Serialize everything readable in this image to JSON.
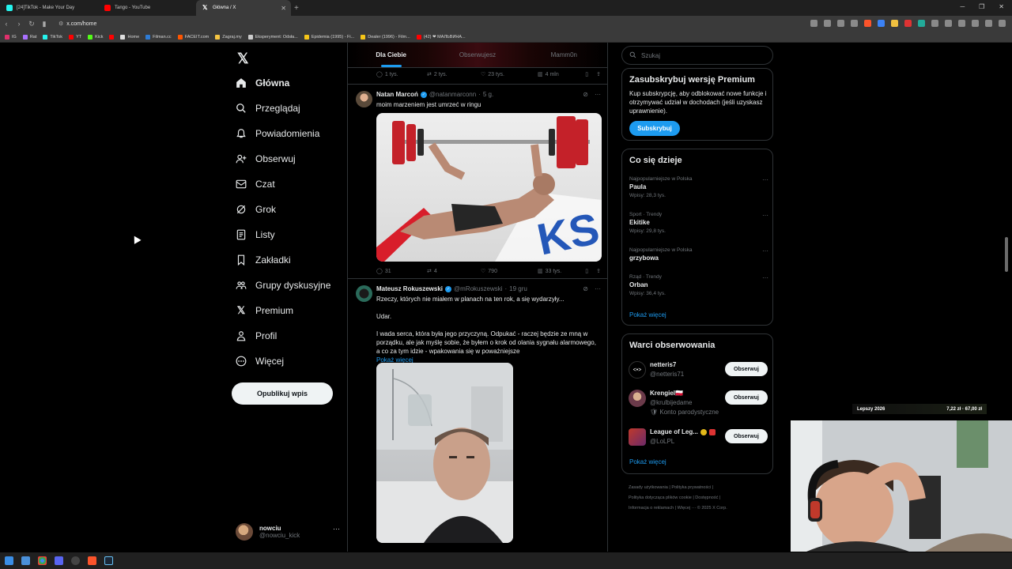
{
  "browser": {
    "tabs": [
      {
        "title": "[24]TikTok - Make Your Day",
        "color": "#25f4ee"
      },
      {
        "title": "Tango - YouTube",
        "color": "#ff0000"
      },
      {
        "title": "Główna / X",
        "color": "#ffffff",
        "active": true
      }
    ],
    "url": "x.com/home",
    "bookmarks": [
      {
        "label": "IG",
        "color": "#e1306c"
      },
      {
        "label": "Rat",
        "color": "#a970ff"
      },
      {
        "label": "TikTok",
        "color": "#25f4ee"
      },
      {
        "label": "YT",
        "color": "#ff0000"
      },
      {
        "label": "Kick",
        "color": "#53fc18"
      },
      {
        "label": "",
        "color": "#ff0000"
      },
      {
        "label": "Home",
        "color": "#ffffff"
      },
      {
        "label": "Filman.cc",
        "color": "#2e7cd6"
      },
      {
        "label": "FACEIT.com",
        "color": "#ff5500"
      },
      {
        "label": "Zagraj.my",
        "color": "#f5c542"
      },
      {
        "label": "Eksperyment: Odsła...",
        "color": "#cccccc"
      },
      {
        "label": "Epidemia (1995) - Fi...",
        "color": "#f5c518"
      },
      {
        "label": "Dealer (1996) - Film...",
        "color": "#f5c518"
      },
      {
        "label": "(42) ❤ МАЛЬВИНА...",
        "color": "#888888"
      }
    ]
  },
  "nav": {
    "items": [
      {
        "label": "Główna",
        "icon": "home-icon"
      },
      {
        "label": "Przeglądaj",
        "icon": "search-icon"
      },
      {
        "label": "Powiadomienia",
        "icon": "bell-icon"
      },
      {
        "label": "Obserwuj",
        "icon": "follow-icon"
      },
      {
        "label": "Czat",
        "icon": "mail-icon"
      },
      {
        "label": "Grok",
        "icon": "grok-icon"
      },
      {
        "label": "Listy",
        "icon": "list-icon"
      },
      {
        "label": "Zakładki",
        "icon": "bookmark-icon"
      },
      {
        "label": "Grupy dyskusyjne",
        "icon": "community-icon"
      },
      {
        "label": "Premium",
        "icon": "x-icon"
      },
      {
        "label": "Profil",
        "icon": "profile-icon"
      },
      {
        "label": "Więcej",
        "icon": "more-icon"
      }
    ],
    "post_button": "Opublikuj wpis",
    "profile": {
      "name": "nowciu",
      "handle": "@nowciu_kick"
    }
  },
  "timeline": {
    "tabs": [
      "Dla Ciebie",
      "Obserwujesz",
      "Mamm0n"
    ],
    "prev_actions": {
      "replies": "1 tys.",
      "reposts": "2 tys.",
      "likes": "23 tys.",
      "views": "4 mln"
    },
    "posts": [
      {
        "name": "Natan Marcoń",
        "handle": "@natanmarconn",
        "time": "5 g.",
        "text": "moim marzeniem jest umrzeć w ringu",
        "actions": {
          "replies": "31",
          "reposts": "4",
          "likes": "790",
          "views": "33 tys."
        }
      },
      {
        "name": "Mateusz Rokuszewski",
        "handle": "@mRokuszewski",
        "time": "19 gru",
        "line1": "Rzeczy, których nie miałem w planach na ten rok, a się wydarzyły...",
        "line2": "Udar.",
        "line3": "I wada serca, która była jego przyczyną. Odpukać - raczej będzie ze mną w porządku, ale jak myślę sobie, że byłem o krok od olania sygnału alarmowego, a co za tym idzie - wpakowania się w poważniejsze",
        "show_more": "Pokaż więcej"
      }
    ]
  },
  "sidebar": {
    "search_placeholder": "Szukaj",
    "premium": {
      "title": "Zasubskrybuj wersję Premium",
      "text": "Kup subskrypcję, aby odblokować nowe funkcje i otrzymywać udział w dochodach (jeśli uzyskasz uprawnienie).",
      "button": "Subskrybuj"
    },
    "trends": {
      "title": "Co się dzieje",
      "items": [
        {
          "meta": "Najpopularniejsze w Polska",
          "name": "Paula",
          "count": "Wpisy: 28,3 tys."
        },
        {
          "meta": "Sport · Trendy",
          "name": "Ekitike",
          "count": "Wpisy: 29,8 tys."
        },
        {
          "meta": "Najpopularniejsze w Polska",
          "name": "grzybowa",
          "count": ""
        },
        {
          "meta": "Rząd · Trendy",
          "name": "Orban",
          "count": "Wpisy: 36,4 tys."
        }
      ],
      "show_more": "Pokaż więcej"
    },
    "who_to_follow": {
      "title": "Warci obserwowania",
      "items": [
        {
          "name": "netteris7",
          "handle": "@netteris71",
          "note": ""
        },
        {
          "name": "Krengiel🇵🇱",
          "handle": "@krulbijedame",
          "note": "🛡 Konto parodystyczne"
        },
        {
          "name": "League of Leg...",
          "handle": "@LoLPL",
          "note": ""
        }
      ],
      "button": "Obserwuj",
      "show_more": "Pokaż więcej"
    },
    "footer": {
      "l1a": "Zasady użytkowania",
      "l1b": "Polityka prywatności",
      "l2a": "Polityka dotycząca plików cookie",
      "l2b": "Dostępność",
      "l3a": "Informacja o reklamach",
      "l3b": "Więcej ···",
      "l3c": "© 2025 X Corp."
    }
  },
  "overlay": {
    "left": "Lepszy 2026",
    "right": "7,22 zł · 67,00 zł"
  }
}
